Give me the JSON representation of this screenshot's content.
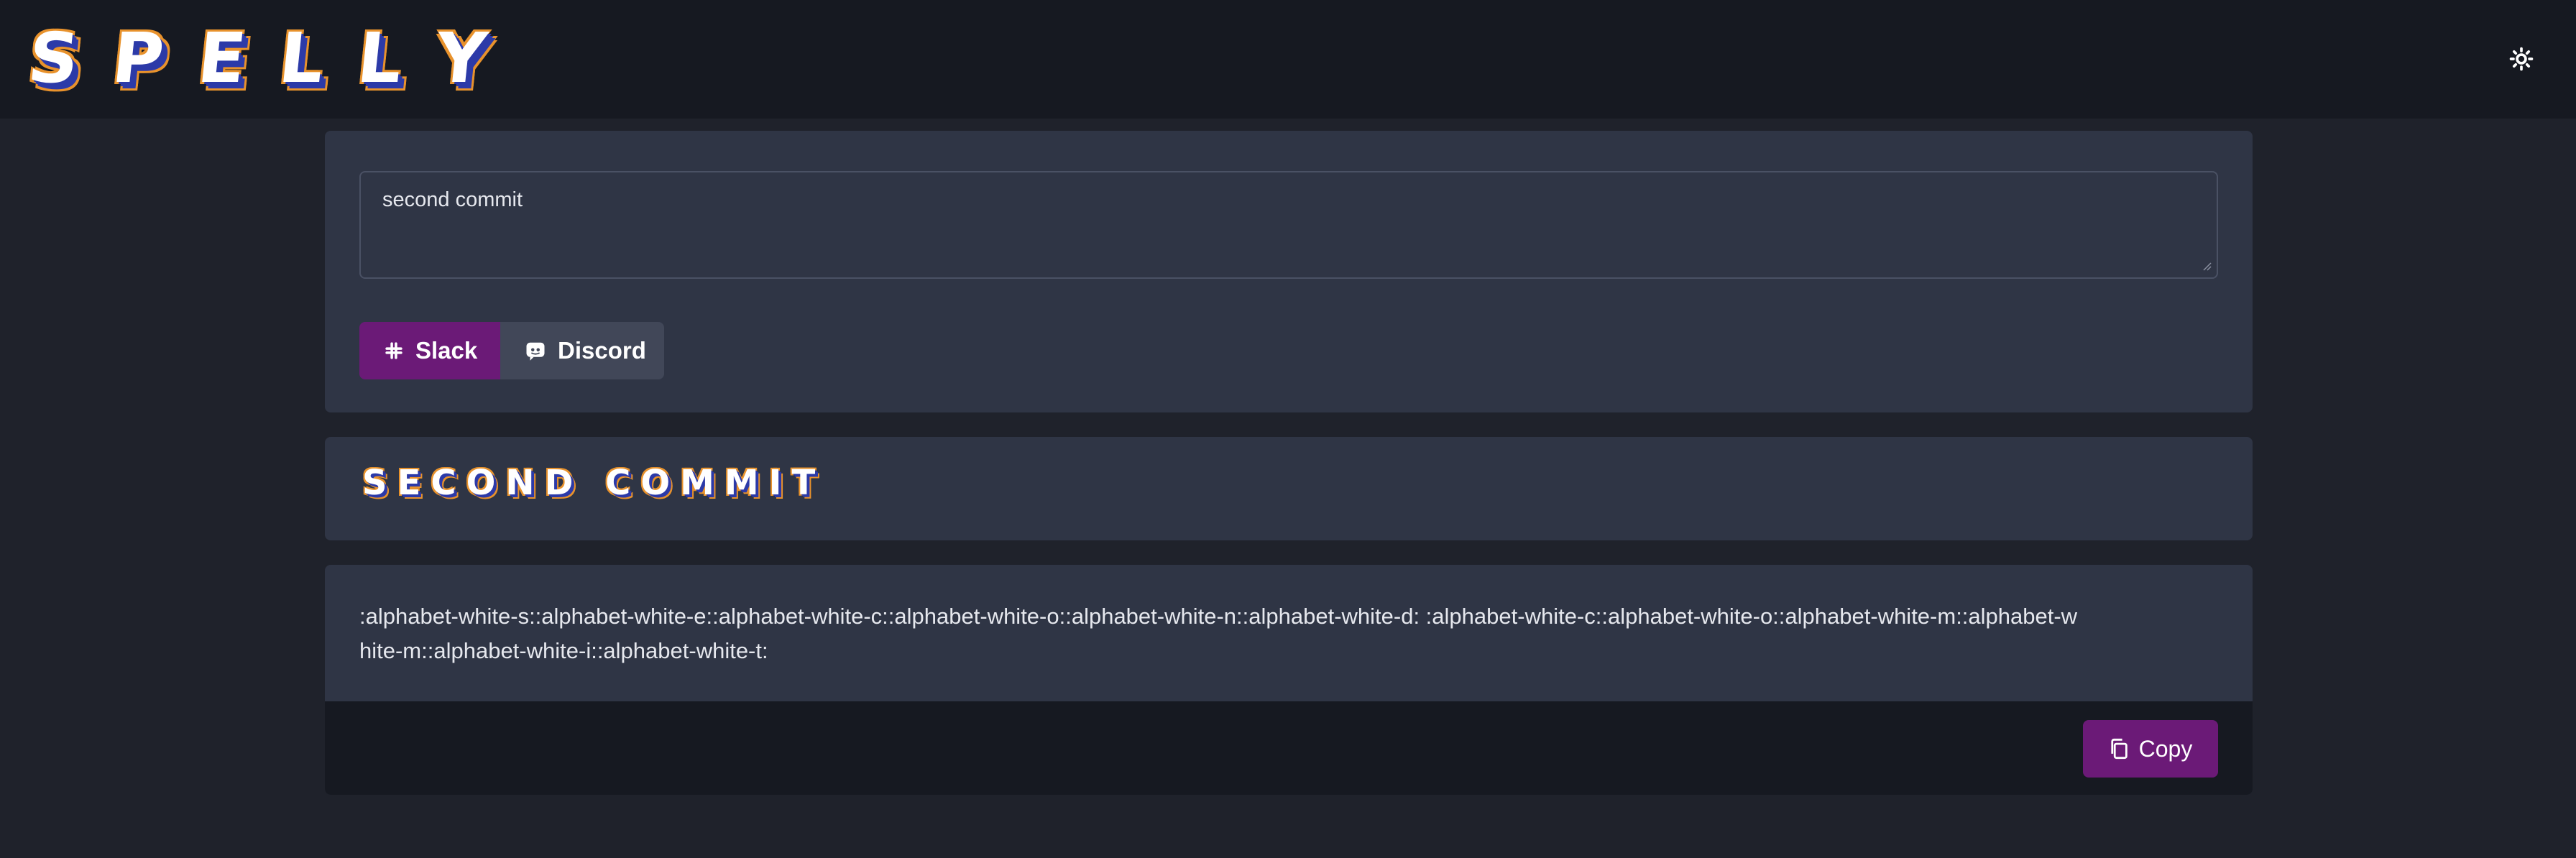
{
  "app": {
    "logo_letters": [
      "S",
      "P",
      "E",
      "L",
      "L",
      "Y"
    ],
    "theme_icon": "sun-icon"
  },
  "input": {
    "value": "second commit"
  },
  "platform": {
    "options": [
      {
        "label": "Slack",
        "icon": "slack-icon",
        "selected": true
      },
      {
        "label": "Discord",
        "icon": "discord-icon",
        "selected": false
      }
    ]
  },
  "preview": {
    "title": "SECOND COMMIT"
  },
  "output": {
    "text": ":alphabet-white-s::alphabet-white-e::alphabet-white-c::alphabet-white-o::alphabet-white-n::alphabet-white-d:   :alphabet-white-c::alphabet-white-o::alphabet-white-m::alphabet-white-m::alphabet-white-i::alphabet-white-t:",
    "copy_label": "Copy",
    "copy_icon": "copy-icon"
  },
  "colors": {
    "accent": "#6b1a77",
    "background": "#1f222b",
    "card": "#2f3545",
    "header": "#161921",
    "logo_outline": "#e8922c",
    "logo_shadow": "#2c3aa8"
  }
}
